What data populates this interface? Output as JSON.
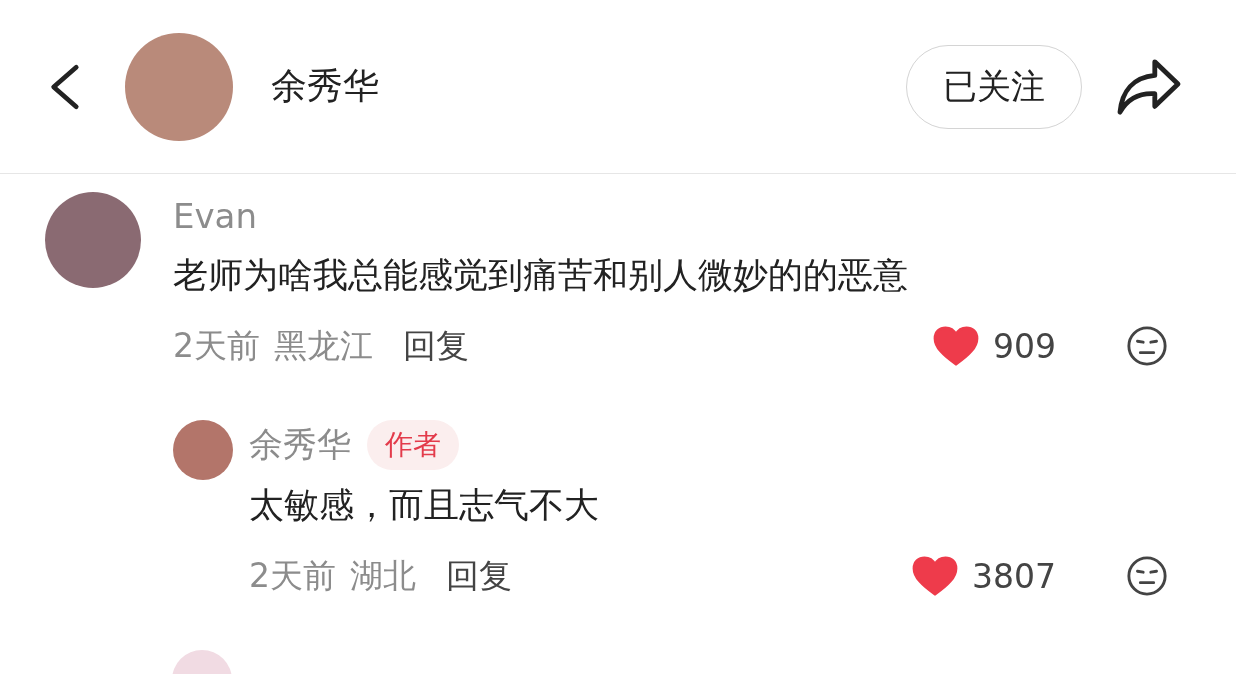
{
  "header": {
    "name": "余秀华",
    "follow_button": {
      "label": "已关注",
      "followed": true
    }
  },
  "comments": [
    {
      "author": "Evan",
      "content": "老师为啥我总能感觉到痛苦和别人微妙的的恶意",
      "time": "2天前",
      "location": "黑龙江",
      "reply_label": "回复",
      "likes": "909",
      "liked": true,
      "replies": [
        {
          "author": "余秀华",
          "badge": "作者",
          "content": "太敏感，而且志气不大",
          "time": "2天前",
          "location": "湖北",
          "reply_label": "回复",
          "likes": "3807",
          "liked": true
        }
      ]
    }
  ]
}
